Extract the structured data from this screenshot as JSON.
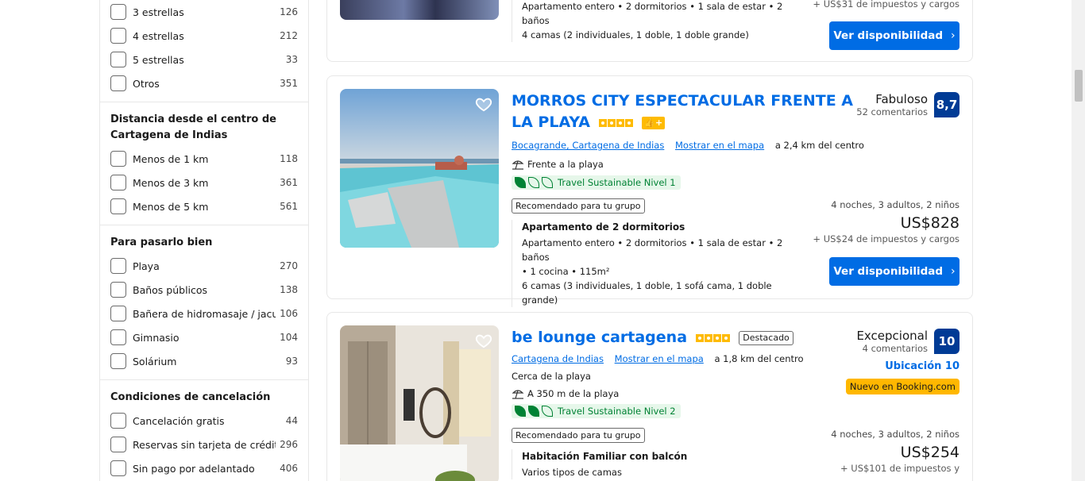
{
  "filters": {
    "stars_opts": [
      {
        "label": "3 estrellas",
        "count": "126"
      },
      {
        "label": "4 estrellas",
        "count": "212"
      },
      {
        "label": "5 estrellas",
        "count": "33"
      },
      {
        "label": "Otros",
        "count": "351"
      }
    ],
    "distance_title": "Distancia desde el centro de Cartagena de Indias",
    "distance_opts": [
      {
        "label": "Menos de 1 km",
        "count": "118"
      },
      {
        "label": "Menos de 3 km",
        "count": "361"
      },
      {
        "label": "Menos de 5 km",
        "count": "561"
      }
    ],
    "fun_title": "Para pasarlo bien",
    "fun_opts": [
      {
        "label": "Playa",
        "count": "270"
      },
      {
        "label": "Baños públicos",
        "count": "138"
      },
      {
        "label": "Bañera de hidromasaje / jacuzzi",
        "count": "106"
      },
      {
        "label": "Gimnasio",
        "count": "104"
      },
      {
        "label": "Solárium",
        "count": "93"
      }
    ],
    "cancel_title": "Condiciones de cancelación",
    "cancel_opts": [
      {
        "label": "Cancelación gratis",
        "count": "44"
      },
      {
        "label": "Reservas sin tarjeta de crédito",
        "count": "296"
      },
      {
        "label": "Sin pago por adelantado",
        "count": "406"
      }
    ]
  },
  "card0": {
    "unit_line1": "Apartamento entero • 2 dormitorios • 1 sala de estar • 2 baños",
    "unit_line2": "4 camas (2 individuales, 1 doble, 1 doble grande)",
    "taxes": "+ US$31 de impuestos y cargos",
    "button": "Ver disponibilidad"
  },
  "card1": {
    "title": "MORROS CITY ESPECTACULAR FRENTE A LA PLAYA",
    "location": "Bocagrande, Cartagena de Indias",
    "map_link": "Mostrar en el mapa",
    "distance": "a 2,4 km del centro",
    "beach": "Frente a la playa",
    "sustainable": "Travel Sustainable Nivel 1",
    "recommended": "Recomendado para tu grupo",
    "unit_name": "Apartamento de 2 dormitorios",
    "unit_line1": "Apartamento entero • 2 dormitorios • 1 sala de estar • 2 baños",
    "unit_line2": "• 1 cocina • 115m²",
    "unit_line3": "6 camas (3 individuales, 1 doble, 1 sofá cama, 1 doble grande)",
    "review_word": "Fabuloso",
    "review_count": "52 comentarios",
    "score": "8,7",
    "stay": "4 noches, 3 adultos, 2 niños",
    "price": "US$828",
    "taxes": "+ US$24 de impuestos y cargos",
    "button": "Ver disponibilidad"
  },
  "card2": {
    "title": "be lounge cartagena",
    "featured": "Destacado",
    "location": "Cartagena de Indias",
    "map_link": "Mostrar en el mapa",
    "distance": "a 1,8 km del centro",
    "near_beach": "Cerca de la playa",
    "beach_dist": "A 350 m de la playa",
    "sustainable": "Travel Sustainable Nivel 2",
    "recommended": "Recomendado para tu grupo",
    "unit_name": "Habitación Familiar con balcón",
    "unit_line1": "Varios tipos de camas",
    "review_word": "Excepcional",
    "review_count": "4 comentarios",
    "score": "10",
    "location_score": "Ubicación 10",
    "new_badge": "Nuevo en Booking.com",
    "stay": "4 noches, 3 adultos, 2 niños",
    "price": "US$254",
    "taxes": "+ US$101 de impuestos y"
  },
  "colors": {
    "accent": "#006ce4",
    "score_bg": "#003b95",
    "star": "#febb02",
    "green": "#008234"
  }
}
